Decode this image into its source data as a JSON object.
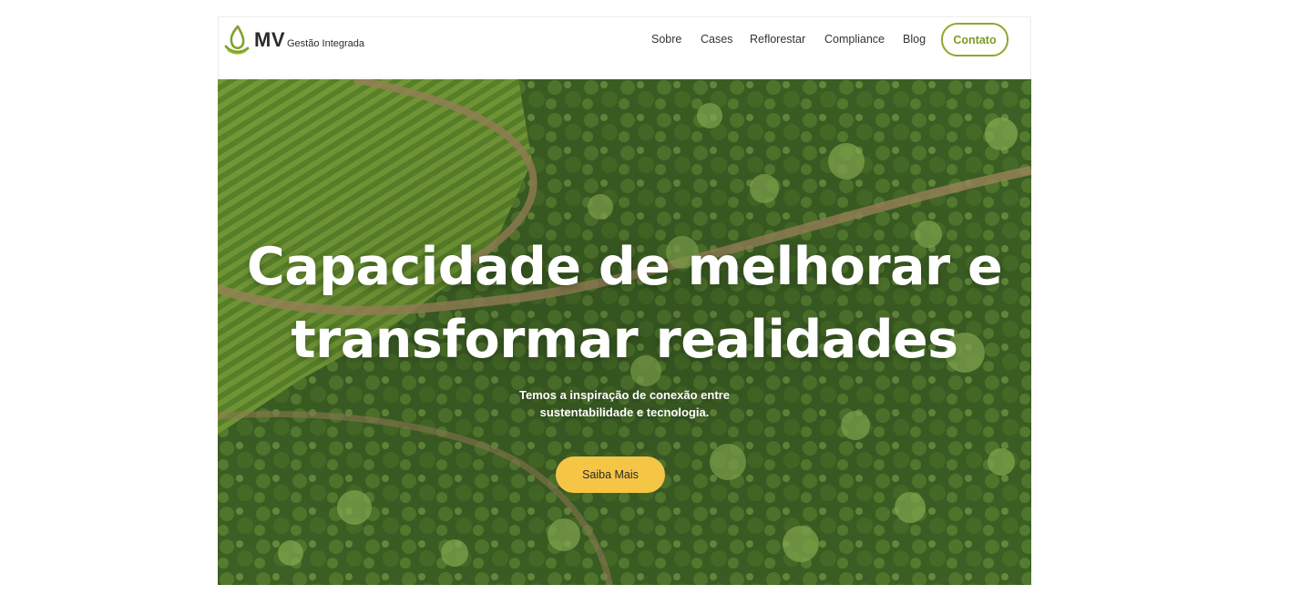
{
  "brand": {
    "mark": "MV",
    "tagline": "Gestão Integrada",
    "logo_icon": "leaf-drop-icon",
    "accent_color": "#8ba82e"
  },
  "nav": {
    "items": [
      {
        "label": "Sobre"
      },
      {
        "label": "Cases"
      },
      {
        "label": "Reflorestar"
      },
      {
        "label": "Compliance"
      },
      {
        "label": "Blog"
      }
    ],
    "contact_label": "Contato"
  },
  "hero": {
    "title_line1": "Capacidade de melhorar e",
    "title_line2": "transformar realidades",
    "subtitle_line1": "Temos a inspiração de conexão entre",
    "subtitle_line2": "sustentabilidade e tecnologia.",
    "cta_label": "Saiba Mais",
    "cta_color": "#f5c546",
    "background": "aerial-farm-forest-image"
  }
}
